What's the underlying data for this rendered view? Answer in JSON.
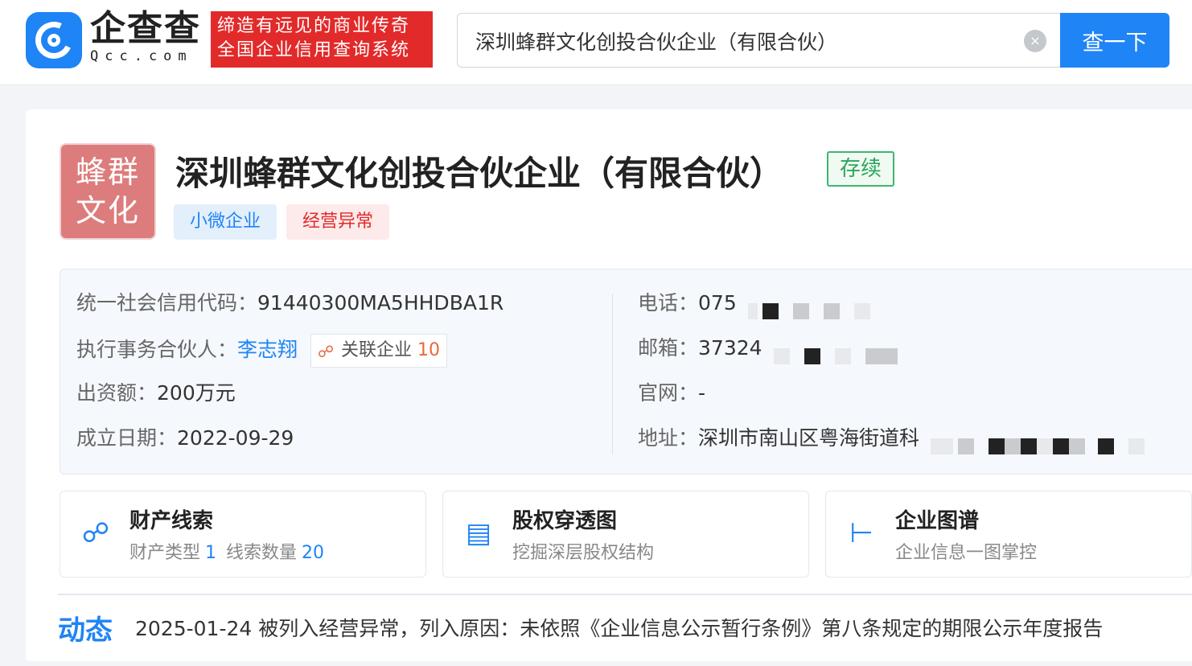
{
  "header": {
    "brand_cn": "企查查",
    "brand_en": "Qcc.com",
    "slogan_line1": "缔造有远见的商业传奇",
    "slogan_line2": "全国企业信用查询系统",
    "search_value": "深圳蜂群文化创投合伙企业（有限合伙）",
    "clear_icon": "×",
    "search_button": "查一下"
  },
  "company": {
    "logo_line1": "蜂群",
    "logo_line2": "文化",
    "name": "深圳蜂群文化创投合伙企业（有限合伙）",
    "status": "存续",
    "tags": [
      "小微企业",
      "经营异常"
    ]
  },
  "info": {
    "credit_code_label": "统一社会信用代码：",
    "credit_code": "91440300MA5HHDBA1R",
    "partner_label": "执行事务合伙人：",
    "partner": "李志翔",
    "related_label": "关联企业",
    "related_count": "10",
    "capital_label": "出资额：",
    "capital": "200万元",
    "date_label": "成立日期：",
    "date": "2022-09-29",
    "phone_label": "电话：",
    "phone": "075",
    "email_label": "邮箱：",
    "email": "37324",
    "website_label": "官网：",
    "website": "-",
    "address_label": "地址：",
    "address": "深圳市南山区粤海街道科"
  },
  "features": [
    {
      "title": "财产线索",
      "sub1": "财产类型",
      "val1": "1",
      "sub2": "线索数量",
      "val2": "20"
    },
    {
      "title": "股权穿透图",
      "sub": "挖掘深层股权结构"
    },
    {
      "title": "企业图谱",
      "sub": "企业信息一图掌控"
    }
  ],
  "news": {
    "title": "动态",
    "text": "2025-01-24 被列入经营异常，列入原因：未依照《企业信息公示暂行条例》第八条规定的期限公示年度报告"
  },
  "colors": {
    "accent": "#1f84f5",
    "slogan_bg": "#e22a2a",
    "status": "#2ba65d",
    "logo_bg": "#dd7c7c"
  }
}
